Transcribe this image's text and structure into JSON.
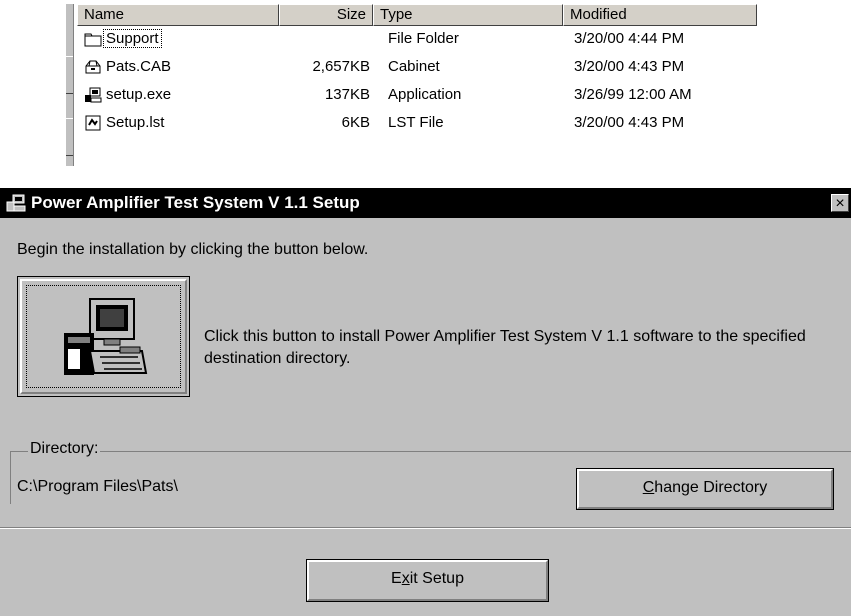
{
  "explorer": {
    "columns": {
      "name": "Name",
      "size": "Size",
      "type": "Type",
      "modified": "Modified"
    },
    "files": [
      {
        "name": "Support",
        "size": "",
        "type": "File Folder",
        "modified": "3/20/00 4:44 PM",
        "icon": "folder-icon"
      },
      {
        "name": "Pats.CAB",
        "size": "2,657KB",
        "type": "Cabinet",
        "modified": "3/20/00 4:43 PM",
        "icon": "cabinet-icon"
      },
      {
        "name": "setup.exe",
        "size": "137KB",
        "type": "Application",
        "modified": "3/26/99 12:00 AM",
        "icon": "setup-exe-icon"
      },
      {
        "name": "Setup.lst",
        "size": "6KB",
        "type": "LST File",
        "modified": "3/20/00 4:43 PM",
        "icon": "lst-file-icon"
      }
    ]
  },
  "dialog": {
    "title": "Power Amplifier Test System V 1.1 Setup",
    "close_label": "×",
    "intro": "Begin the installation by clicking the button below.",
    "install_description": "Click this button to install Power Amplifier Test System V 1.1 software to the specified destination directory.",
    "directory_label": "Directory:",
    "directory_value": "C:\\Program Files\\Pats\\",
    "change_button": {
      "accel": "C",
      "rest": "hange Directory"
    },
    "exit_button": {
      "pre": "E",
      "accel": "x",
      "rest": "it Setup"
    }
  }
}
